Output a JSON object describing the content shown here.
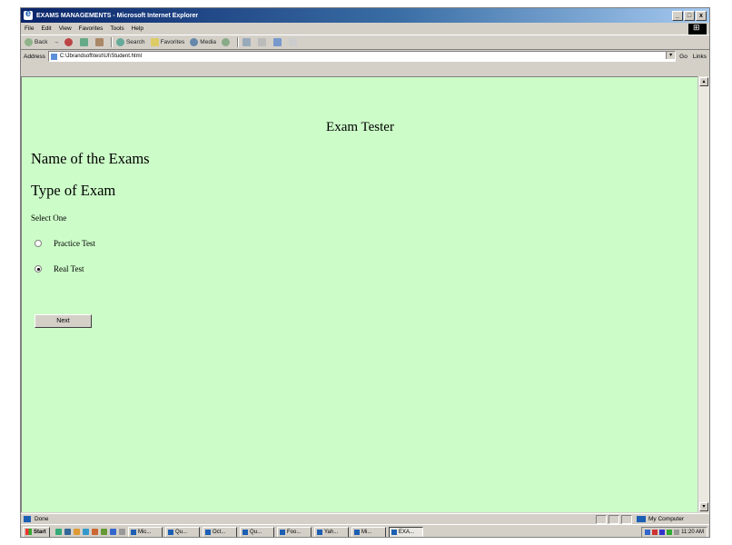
{
  "window": {
    "title": "EXAMS MANAGEMENTS - Microsoft Internet Explorer",
    "buttons": {
      "minimize": "_",
      "maximize": "□",
      "close": "x"
    }
  },
  "menu": [
    "File",
    "Edit",
    "View",
    "Favorites",
    "Tools",
    "Help"
  ],
  "toolbar": {
    "back": "Back",
    "forward": "→",
    "search": "Search",
    "favorites": "Favorites",
    "media": "Media"
  },
  "address": {
    "label": "Address",
    "value": "C:\\Jbrandsoft\\test\\UI\\Student.html",
    "go": "Go",
    "links": "Links"
  },
  "page": {
    "title": "Exam Tester",
    "heading_exams": "Name of the Exams",
    "heading_type": "Type of Exam",
    "select_label": "Select One",
    "options": [
      {
        "label": "Practice Test",
        "checked": false
      },
      {
        "label": "Real Test",
        "checked": true
      }
    ],
    "next_label": "Next",
    "background_color": "#ccfcc8"
  },
  "status": {
    "text": "Done",
    "zone": "My Computer"
  },
  "taskbar": {
    "start": "Start",
    "tasks": [
      "Mic...",
      "Qu...",
      "Oct...",
      "Qu...",
      "Foo...",
      "Yah...",
      "Mi...",
      "EXA..."
    ],
    "clock": "11:20 AM"
  }
}
